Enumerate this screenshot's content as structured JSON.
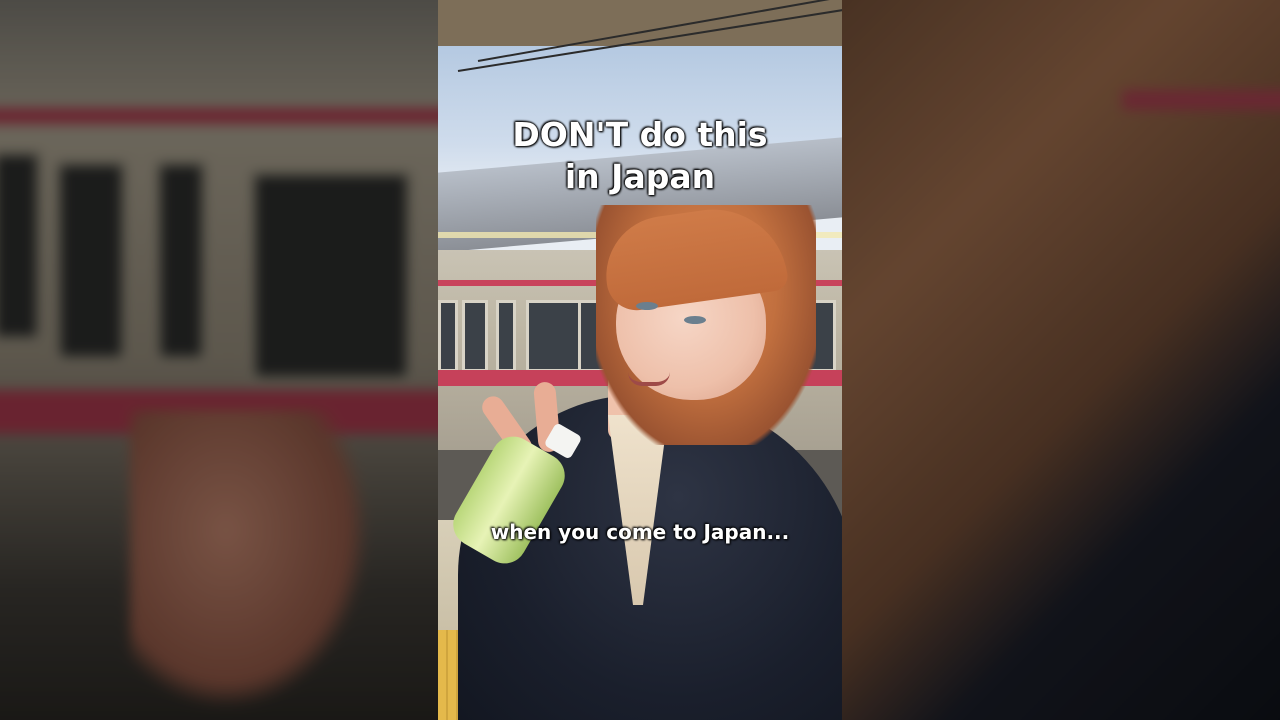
{
  "video": {
    "title_line1": "DON'T do this",
    "title_line2": "in Japan",
    "subtitle": "when you come to Japan..."
  },
  "colors": {
    "train_stripe": "#c6415a",
    "caption_text": "#ffffff",
    "jacket": "#1a1f2c",
    "hair": "#c2703f"
  }
}
